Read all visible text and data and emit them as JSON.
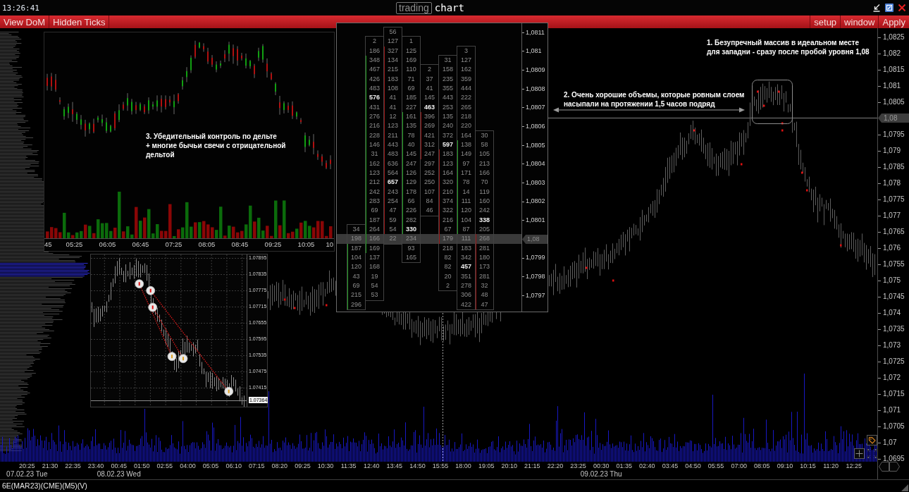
{
  "title_bar": {
    "clock": "13:26:41",
    "app_name": "trading",
    "title": "chart"
  },
  "toolbar": {
    "left": [
      "View DoM",
      "Hidden Ticks"
    ],
    "right": [
      "setup",
      "window",
      "Apply"
    ]
  },
  "chart": {
    "annotations": [
      {
        "lines": [
          "1. Безупречный массив в идеальном месте",
          "для западни - сразу после пробой уровня 1,08"
        ]
      },
      {
        "lines": [
          "2. Очень хорошие объемы, которые ровным слоем",
          "насыпали на протяжении 1,5 часов подряд"
        ]
      }
    ],
    "price_axis": [
      {
        "label": "1,0825",
        "highlighted": false
      },
      {
        "label": "1,082",
        "highlighted": false
      },
      {
        "label": "1,0815",
        "highlighted": false
      },
      {
        "label": "1,081",
        "highlighted": false
      },
      {
        "label": "1,0805",
        "highlighted": false
      },
      {
        "label": "1,08",
        "highlighted": true
      },
      {
        "label": "1,0795",
        "highlighted": false
      },
      {
        "label": "1,079",
        "highlighted": false
      },
      {
        "label": "1,0785",
        "highlighted": false
      },
      {
        "label": "1,078",
        "highlighted": false
      },
      {
        "label": "1,0775",
        "highlighted": false
      },
      {
        "label": "1,077",
        "highlighted": false
      },
      {
        "label": "1,0765",
        "highlighted": false
      },
      {
        "label": "1,076",
        "highlighted": false
      },
      {
        "label": "1,0755",
        "highlighted": false
      },
      {
        "label": "1,075",
        "highlighted": false
      },
      {
        "label": "1,0745",
        "highlighted": false
      },
      {
        "label": "1,074",
        "highlighted": false
      },
      {
        "label": "1,0735",
        "highlighted": false
      },
      {
        "label": "1,073",
        "highlighted": false
      },
      {
        "label": "1,0725",
        "highlighted": false
      },
      {
        "label": "1,072",
        "highlighted": false
      },
      {
        "label": "1,0715",
        "highlighted": false
      },
      {
        "label": "1,071",
        "highlighted": false
      },
      {
        "label": "1,0705",
        "highlighted": false
      },
      {
        "label": "1,07",
        "highlighted": false
      },
      {
        "label": "1,0695",
        "highlighted": false
      }
    ],
    "time_axis": [
      {
        "label": "20:25",
        "date": "07.02.23 Tue"
      },
      {
        "label": "21:30"
      },
      {
        "label": "22:35"
      },
      {
        "label": "23:40"
      },
      {
        "label": "00:45",
        "date": "08.02.23 Wed"
      },
      {
        "label": "01:50"
      },
      {
        "label": "02:55"
      },
      {
        "label": "04:00"
      },
      {
        "label": "05:05"
      },
      {
        "label": "06:10"
      },
      {
        "label": "07:15"
      },
      {
        "label": "08:20"
      },
      {
        "label": "09:25"
      },
      {
        "label": "10:30"
      },
      {
        "label": "11:35"
      },
      {
        "label": "12:40"
      },
      {
        "label": "13:45"
      },
      {
        "label": "14:50"
      },
      {
        "label": "15:55"
      },
      {
        "label": "18:00"
      },
      {
        "label": "19:05"
      },
      {
        "label": "20:10"
      },
      {
        "label": "21:15"
      },
      {
        "label": "22:20"
      },
      {
        "label": "23:25"
      },
      {
        "label": "00:30",
        "date": "09.02.23 Thu"
      },
      {
        "label": "01:35"
      },
      {
        "label": "02:40"
      },
      {
        "label": "03:45"
      },
      {
        "label": "04:50"
      },
      {
        "label": "05:55"
      },
      {
        "label": "07:00"
      },
      {
        "label": "08:05"
      },
      {
        "label": "09:10"
      },
      {
        "label": "10:15"
      },
      {
        "label": "11:20"
      },
      {
        "label": "12:25"
      }
    ]
  },
  "delta_inset": {
    "note": {
      "lines": [
        "3. Убедительный контроль по дельте",
        "+ многие бычьи свечи с отрицательной",
        "дельтой"
      ]
    },
    "time_axis": [
      "45",
      "05:25",
      "06:05",
      "06:45",
      "07:25",
      "08:05",
      "08:45",
      "09:25",
      "10:05",
      "10"
    ]
  },
  "trend_inset": {
    "price_axis": [
      {
        "label": "1.07895",
        "highlighted": false
      },
      {
        "label": "1.07835",
        "highlighted": false
      },
      {
        "label": "1.07775",
        "highlighted": false
      },
      {
        "label": "1.07715",
        "highlighted": false
      },
      {
        "label": "1.07655",
        "highlighted": false
      },
      {
        "label": "1.07595",
        "highlighted": false
      },
      {
        "label": "1.07535",
        "highlighted": false
      },
      {
        "label": "1.07475",
        "highlighted": false
      },
      {
        "label": "1.07415",
        "highlighted": false
      },
      {
        "label": "1.07364",
        "highlighted": true
      }
    ]
  },
  "footprint_inset": {
    "price_axis": [
      {
        "label": "1,0811",
        "highlighted": false
      },
      {
        "label": "1,081",
        "highlighted": false
      },
      {
        "label": "1,0809",
        "highlighted": false
      },
      {
        "label": "1,0808",
        "highlighted": false
      },
      {
        "label": "1,0807",
        "highlighted": false
      },
      {
        "label": "1,0806",
        "highlighted": false
      },
      {
        "label": "1,0805",
        "highlighted": false
      },
      {
        "label": "1,0804",
        "highlighted": false
      },
      {
        "label": "1,0803",
        "highlighted": false
      },
      {
        "label": "1,0802",
        "highlighted": false
      },
      {
        "label": "1,0801",
        "highlighted": false
      },
      {
        "label": "1,08",
        "highlighted": true
      },
      {
        "label": "1,0799",
        "highlighted": false
      },
      {
        "label": "1,0798",
        "highlighted": false
      },
      {
        "label": "1,0797",
        "highlighted": false
      }
    ],
    "columns": [
      {
        "bullish": true,
        "cells": [
          null,
          null,
          null,
          null,
          null,
          null,
          null,
          null,
          null,
          null,
          null,
          null,
          null,
          null,
          null,
          null,
          null,
          null,
          null,
          null,
          null,
          {
            "v": "34",
            "body": false,
            "peak": false
          },
          {
            "v": "198",
            "body": false,
            "peak": false
          },
          {
            "v": "187",
            "body": true,
            "peak": false
          },
          {
            "v": "104",
            "body": true,
            "peak": false
          },
          {
            "v": "120",
            "body": true,
            "peak": false
          },
          {
            "v": "43",
            "body": true,
            "peak": false
          },
          {
            "v": "69",
            "body": true,
            "peak": false
          },
          {
            "v": "215",
            "body": true,
            "peak": false
          },
          {
            "v": "296",
            "body": true,
            "peak": false
          }
        ]
      },
      {
        "bullish": true,
        "cells": [
          null,
          {
            "v": "2",
            "body": false,
            "peak": false
          },
          {
            "v": "186",
            "body": false,
            "peak": false
          },
          {
            "v": "348",
            "body": true,
            "peak": false
          },
          {
            "v": "467",
            "body": true,
            "peak": false
          },
          {
            "v": "426",
            "body": true,
            "peak": false
          },
          {
            "v": "483",
            "body": true,
            "peak": false
          },
          {
            "v": "576",
            "body": true,
            "peak": true
          },
          {
            "v": "431",
            "body": true,
            "peak": false
          },
          {
            "v": "276",
            "body": true,
            "peak": false
          },
          {
            "v": "216",
            "body": true,
            "peak": false
          },
          {
            "v": "228",
            "body": true,
            "peak": false
          },
          {
            "v": "146",
            "body": true,
            "peak": false
          },
          {
            "v": "31",
            "body": true,
            "peak": false
          },
          {
            "v": "162",
            "body": true,
            "peak": false
          },
          {
            "v": "123",
            "body": true,
            "peak": false
          },
          {
            "v": "212",
            "body": true,
            "peak": false
          },
          {
            "v": "242",
            "body": true,
            "peak": false
          },
          {
            "v": "283",
            "body": true,
            "peak": false
          },
          {
            "v": "69",
            "body": true,
            "peak": false
          },
          {
            "v": "187",
            "body": true,
            "peak": false
          },
          {
            "v": "264",
            "body": true,
            "peak": false
          },
          {
            "v": "166",
            "body": true,
            "peak": false
          },
          {
            "v": "169",
            "body": true,
            "peak": false
          },
          {
            "v": "137",
            "body": false,
            "peak": false
          },
          {
            "v": "168",
            "body": false,
            "peak": false
          },
          {
            "v": "19",
            "body": false,
            "peak": false
          },
          {
            "v": "54",
            "body": false,
            "peak": false
          },
          {
            "v": "53",
            "body": false,
            "peak": false
          }
        ]
      },
      {
        "bullish": false,
        "cells": [
          {
            "v": "56",
            "body": false,
            "peak": false
          },
          {
            "v": "127",
            "body": false,
            "peak": false
          },
          {
            "v": "327",
            "body": true,
            "peak": false
          },
          {
            "v": "134",
            "body": true,
            "peak": false
          },
          {
            "v": "215",
            "body": true,
            "peak": false
          },
          {
            "v": "183",
            "body": true,
            "peak": false
          },
          {
            "v": "108",
            "body": true,
            "peak": false
          },
          {
            "v": "41",
            "body": true,
            "peak": false
          },
          {
            "v": "41",
            "body": true,
            "peak": false
          },
          {
            "v": "12",
            "body": true,
            "peak": false
          },
          {
            "v": "123",
            "body": true,
            "peak": false
          },
          {
            "v": "211",
            "body": true,
            "peak": false
          },
          {
            "v": "443",
            "body": true,
            "peak": false
          },
          {
            "v": "483",
            "body": true,
            "peak": false
          },
          {
            "v": "636",
            "body": true,
            "peak": false
          },
          {
            "v": "564",
            "body": true,
            "peak": false
          },
          {
            "v": "657",
            "body": true,
            "peak": true
          },
          {
            "v": "243",
            "body": true,
            "peak": false
          },
          {
            "v": "254",
            "body": true,
            "peak": false
          },
          {
            "v": "47",
            "body": true,
            "peak": false
          },
          {
            "v": "59",
            "body": true,
            "peak": false
          },
          {
            "v": "54",
            "body": true,
            "peak": false
          },
          {
            "v": "22",
            "body": false,
            "peak": false
          }
        ]
      },
      {
        "bullish": true,
        "cells": [
          null,
          {
            "v": "1",
            "body": false,
            "peak": false
          },
          {
            "v": "125",
            "body": false,
            "peak": false
          },
          {
            "v": "169",
            "body": false,
            "peak": false
          },
          {
            "v": "110",
            "body": false,
            "peak": false
          },
          {
            "v": "71",
            "body": false,
            "peak": false
          },
          {
            "v": "69",
            "body": false,
            "peak": false
          },
          {
            "v": "185",
            "body": false,
            "peak": false
          },
          {
            "v": "227",
            "body": false,
            "peak": false
          },
          {
            "v": "161",
            "body": true,
            "peak": false
          },
          {
            "v": "135",
            "body": true,
            "peak": false
          },
          {
            "v": "78",
            "body": true,
            "peak": false
          },
          {
            "v": "40",
            "body": true,
            "peak": false
          },
          {
            "v": "145",
            "body": true,
            "peak": false
          },
          {
            "v": "247",
            "body": true,
            "peak": false
          },
          {
            "v": "126",
            "body": true,
            "peak": false
          },
          {
            "v": "129",
            "body": true,
            "peak": false
          },
          {
            "v": "178",
            "body": true,
            "peak": false
          },
          {
            "v": "66",
            "body": true,
            "peak": false
          },
          {
            "v": "226",
            "body": true,
            "peak": false
          },
          {
            "v": "282",
            "body": true,
            "peak": false
          },
          {
            "v": "330",
            "body": true,
            "peak": true
          },
          {
            "v": "234",
            "body": false,
            "peak": false
          },
          {
            "v": "93",
            "body": false,
            "peak": false
          },
          {
            "v": "165",
            "body": false,
            "peak": false
          }
        ]
      },
      {
        "bullish": false,
        "cells": [
          null,
          null,
          null,
          null,
          {
            "v": "2",
            "body": false,
            "peak": false
          },
          {
            "v": "37",
            "body": false,
            "peak": false
          },
          {
            "v": "41",
            "body": false,
            "peak": false
          },
          {
            "v": "145",
            "body": false,
            "peak": false
          },
          {
            "v": "463",
            "body": false,
            "peak": true
          },
          {
            "v": "396",
            "body": true,
            "peak": false
          },
          {
            "v": "269",
            "body": true,
            "peak": false
          },
          {
            "v": "421",
            "body": true,
            "peak": false
          },
          {
            "v": "312",
            "body": true,
            "peak": false
          },
          {
            "v": "247",
            "body": true,
            "peak": false
          },
          {
            "v": "297",
            "body": false,
            "peak": false
          },
          {
            "v": "252",
            "body": false,
            "peak": false
          },
          {
            "v": "250",
            "body": false,
            "peak": false
          },
          {
            "v": "107",
            "body": false,
            "peak": false
          },
          {
            "v": "84",
            "body": false,
            "peak": false
          },
          {
            "v": "46",
            "body": false,
            "peak": false
          }
        ]
      },
      {
        "bullish": false,
        "cells": [
          null,
          null,
          null,
          {
            "v": "31",
            "body": false,
            "peak": false
          },
          {
            "v": "158",
            "body": false,
            "peak": false
          },
          {
            "v": "235",
            "body": false,
            "peak": false
          },
          {
            "v": "355",
            "body": false,
            "peak": false
          },
          {
            "v": "443",
            "body": false,
            "peak": false
          },
          {
            "v": "253",
            "body": false,
            "peak": false
          },
          {
            "v": "135",
            "body": false,
            "peak": false
          },
          {
            "v": "240",
            "body": false,
            "peak": false
          },
          {
            "v": "372",
            "body": false,
            "peak": false
          },
          {
            "v": "597",
            "body": false,
            "peak": true
          },
          {
            "v": "183",
            "body": true,
            "peak": false
          },
          {
            "v": "123",
            "body": true,
            "peak": false
          },
          {
            "v": "164",
            "body": true,
            "peak": false
          },
          {
            "v": "320",
            "body": true,
            "peak": false
          },
          {
            "v": "210",
            "body": true,
            "peak": false
          },
          {
            "v": "374",
            "body": true,
            "peak": false
          },
          {
            "v": "322",
            "body": true,
            "peak": false
          },
          {
            "v": "216",
            "body": true,
            "peak": false
          },
          {
            "v": "67",
            "body": true,
            "peak": false
          },
          {
            "v": "179",
            "body": true,
            "peak": false
          },
          {
            "v": "218",
            "body": false,
            "peak": false
          },
          {
            "v": "82",
            "body": false,
            "peak": false
          },
          {
            "v": "82",
            "body": false,
            "peak": false
          },
          {
            "v": "20",
            "body": false,
            "peak": false
          },
          {
            "v": "2",
            "body": false,
            "peak": false
          }
        ]
      },
      {
        "bullish": true,
        "cells": [
          null,
          null,
          {
            "v": "3",
            "body": false,
            "peak": false
          },
          {
            "v": "127",
            "body": false,
            "peak": false
          },
          {
            "v": "162",
            "body": false,
            "peak": false
          },
          {
            "v": "359",
            "body": false,
            "peak": false
          },
          {
            "v": "444",
            "body": false,
            "peak": false
          },
          {
            "v": "222",
            "body": false,
            "peak": false
          },
          {
            "v": "265",
            "body": false,
            "peak": false
          },
          {
            "v": "218",
            "body": false,
            "peak": false
          },
          {
            "v": "220",
            "body": false,
            "peak": false
          },
          {
            "v": "164",
            "body": false,
            "peak": false
          },
          {
            "v": "138",
            "body": true,
            "peak": false
          },
          {
            "v": "149",
            "body": true,
            "peak": false
          },
          {
            "v": "97",
            "body": true,
            "peak": false
          },
          {
            "v": "171",
            "body": true,
            "peak": false
          },
          {
            "v": "78",
            "body": true,
            "peak": false
          },
          {
            "v": "14",
            "body": true,
            "peak": false
          },
          {
            "v": "111",
            "body": true,
            "peak": false
          },
          {
            "v": "120",
            "body": true,
            "peak": false
          },
          {
            "v": "104",
            "body": true,
            "peak": false
          },
          {
            "v": "87",
            "body": true,
            "peak": false
          },
          {
            "v": "111",
            "body": false,
            "peak": false
          },
          {
            "v": "183",
            "body": false,
            "peak": false
          },
          {
            "v": "342",
            "body": false,
            "peak": false
          },
          {
            "v": "457",
            "body": false,
            "peak": true
          },
          {
            "v": "351",
            "body": false,
            "peak": false
          },
          {
            "v": "278",
            "body": false,
            "peak": false
          },
          {
            "v": "306",
            "body": false,
            "peak": false
          },
          {
            "v": "422",
            "body": false,
            "peak": false
          }
        ]
      },
      {
        "bullish": false,
        "cells": [
          null,
          null,
          null,
          null,
          null,
          null,
          null,
          null,
          null,
          null,
          null,
          {
            "v": "30",
            "body": false,
            "peak": false
          },
          {
            "v": "58",
            "body": false,
            "peak": false
          },
          {
            "v": "105",
            "body": false,
            "peak": false
          },
          {
            "v": "213",
            "body": false,
            "peak": false
          },
          {
            "v": "166",
            "body": false,
            "peak": false
          },
          {
            "v": "70",
            "body": false,
            "peak": false
          },
          {
            "v": "119",
            "body": false,
            "peak": false
          },
          {
            "v": "160",
            "body": false,
            "peak": false
          },
          {
            "v": "242",
            "body": false,
            "peak": false
          },
          {
            "v": "338",
            "body": false,
            "peak": true
          },
          {
            "v": "205",
            "body": false,
            "peak": false
          },
          {
            "v": "268",
            "body": true,
            "peak": false
          },
          {
            "v": "281",
            "body": true,
            "peak": false
          },
          {
            "v": "180",
            "body": true,
            "peak": false
          },
          {
            "v": "173",
            "body": true,
            "peak": false
          },
          {
            "v": "281",
            "body": true,
            "peak": false
          },
          {
            "v": "32",
            "body": true,
            "peak": false
          },
          {
            "v": "48",
            "body": true,
            "peak": false
          },
          {
            "v": "47",
            "body": true,
            "peak": false
          }
        ]
      }
    ]
  },
  "status_bar": {
    "instrument": "6E(MAR23)(CME)(M5)(V)"
  }
}
